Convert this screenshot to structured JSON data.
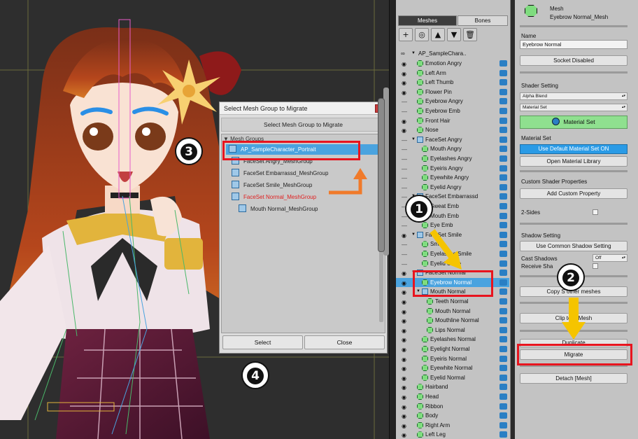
{
  "dialog": {
    "title": "Select Mesh Group to Migrate",
    "close_label": "x",
    "header": "Select Mesh Group to Migrate",
    "section_label": "Mesh Groups",
    "items": [
      {
        "label": "AP_SampleCharacter_Portrait",
        "selected": true,
        "highlight": false
      },
      {
        "label": "FaceSet Angry_MeshGroup",
        "selected": false,
        "highlight": false
      },
      {
        "label": "FaceSet Embarrassd_MeshGroup",
        "selected": false,
        "highlight": false
      },
      {
        "label": "FaceSet Smile_MeshGroup",
        "selected": false,
        "highlight": false
      },
      {
        "label": "FaceSet Normal_MeshGroup",
        "selected": false,
        "highlight": true
      },
      {
        "label": "Mouth Normal_MeshGroup",
        "selected": false,
        "highlight": false
      }
    ],
    "select_label": "Select",
    "cancel_label": "Close"
  },
  "hierarchy": {
    "tabs": [
      "Meshes",
      "Bones"
    ],
    "toolbar": {
      "add": "+",
      "layer": "◎",
      "up": "▲",
      "down": "▼",
      "delete": "🗑"
    },
    "root_label": "AP_SampleChara..",
    "rows": [
      {
        "label": "Emotion Angry",
        "eye": "open",
        "indent": 1
      },
      {
        "label": "Left Arm",
        "eye": "open",
        "indent": 1
      },
      {
        "label": "Left Thumb",
        "eye": "open",
        "indent": 1
      },
      {
        "label": "Flower Pin",
        "eye": "open",
        "indent": 1
      },
      {
        "label": "Eyebrow Angry",
        "eye": "closed",
        "indent": 1
      },
      {
        "label": "Eyebrow Emb",
        "eye": "closed",
        "indent": 1
      },
      {
        "label": "Front Hair",
        "eye": "open",
        "indent": 1
      },
      {
        "label": "Nose",
        "eye": "open",
        "indent": 1
      },
      {
        "label": "FaceSet Angry",
        "eye": "closed",
        "indent": 1,
        "group": true
      },
      {
        "label": "Mouth Angry",
        "eye": "closed",
        "indent": 2
      },
      {
        "label": "Eyelashes Angry",
        "eye": "closed",
        "indent": 2
      },
      {
        "label": "Eyeiris Angry",
        "eye": "closed",
        "indent": 2
      },
      {
        "label": "Eyewhite Angry",
        "eye": "closed",
        "indent": 2
      },
      {
        "label": "Eyelid Angry",
        "eye": "closed",
        "indent": 2
      },
      {
        "label": "FaceSet Embarrassd",
        "eye": "closed",
        "indent": 1,
        "group": true
      },
      {
        "label": "Sweat Emb",
        "eye": "closed",
        "indent": 2
      },
      {
        "label": "Mouth Emb",
        "eye": "closed",
        "indent": 2
      },
      {
        "label": "Eye Emb",
        "eye": "closed",
        "indent": 2
      },
      {
        "label": "FaceSet Smile",
        "eye": "open",
        "indent": 1,
        "group": true
      },
      {
        "label": "Smile",
        "eye": "closed",
        "indent": 2
      },
      {
        "label": "Eyelashes Smile",
        "eye": "closed",
        "indent": 2
      },
      {
        "label": "Eyelid Smile",
        "eye": "closed",
        "indent": 2
      },
      {
        "label": "FaceSet Normal",
        "eye": "open",
        "indent": 1,
        "group": true
      },
      {
        "label": "Eyebrow Normal",
        "eye": "open",
        "indent": 2,
        "selected": true
      },
      {
        "label": "Mouth Normal",
        "eye": "open",
        "indent": 2,
        "group": true
      },
      {
        "label": "Teeth Normal",
        "eye": "open",
        "indent": 3
      },
      {
        "label": "Mouth Normal",
        "eye": "open",
        "indent": 3
      },
      {
        "label": "Mouthline Normal",
        "eye": "open",
        "indent": 3
      },
      {
        "label": "Lips Normal",
        "eye": "open",
        "indent": 3
      },
      {
        "label": "Eyelashes Normal",
        "eye": "open",
        "indent": 2
      },
      {
        "label": "Eyelight Normal",
        "eye": "open",
        "indent": 2
      },
      {
        "label": "Eyeiris Normal",
        "eye": "open",
        "indent": 2
      },
      {
        "label": "Eyewhite Normal",
        "eye": "open",
        "indent": 2
      },
      {
        "label": "Eyelid Normal",
        "eye": "open",
        "indent": 2
      },
      {
        "label": "Hairband",
        "eye": "open",
        "indent": 1
      },
      {
        "label": "Head",
        "eye": "open",
        "indent": 1
      },
      {
        "label": "Ribbon",
        "eye": "open",
        "indent": 1
      },
      {
        "label": "Body",
        "eye": "open",
        "indent": 1
      },
      {
        "label": "Right Arm",
        "eye": "open",
        "indent": 1
      },
      {
        "label": "Left Leg",
        "eye": "open",
        "indent": 1
      }
    ]
  },
  "inspector": {
    "type": "Mesh",
    "object_name": "Eyebrow Normal_Mesh",
    "name_label": "Name",
    "name_value": "Eyebrow Normal",
    "socket_button": "Socket Disabled",
    "shader_setting_label": "Shader Setting",
    "blend_value": "Alpha Blend",
    "material_dropdown": "Material Set",
    "material_set_button": "Material Set",
    "material_set_label": "Material Set",
    "use_default_button": "Use Default Material Set ON",
    "open_library_button": "Open Material Library",
    "custom_shader_label": "Custom Shader Properties",
    "add_custom_button": "Add Custom Property",
    "two_sides_label": "2-Sides",
    "shadow_setting_label": "Shadow Setting",
    "common_shadow_button": "Use Common Shadow Setting",
    "cast_shadows_label": "Cast Shadows",
    "cast_shadows_value": "Off",
    "receive_shadows_label": "Receive Sha",
    "copy_button": "Copy S           other meshes",
    "clip_button": "Clip to         w Mesh",
    "duplicate_button": "Duplicate",
    "migrate_button": "Migrate",
    "detach_button": "Detach [Mesh]"
  },
  "callouts": [
    "1",
    "2",
    "3",
    "4"
  ],
  "colors": {
    "selection": "#4aa3df",
    "callout_red": "#e8141e",
    "arrow_yellow": "#f5c400",
    "arrow_orange": "#f07a2a",
    "material_green": "#8fe08f"
  }
}
